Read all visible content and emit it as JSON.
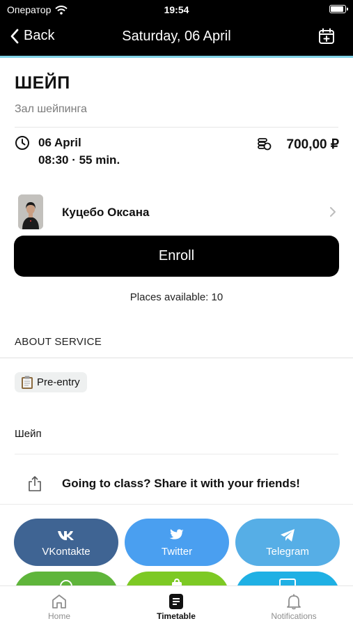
{
  "status_bar": {
    "carrier": "Оператор",
    "time": "19:54"
  },
  "nav": {
    "back_label": "Back",
    "title": "Saturday, 06 April"
  },
  "class": {
    "title": "ШЕЙП",
    "hall": "Зал шейпинга",
    "date": "06 April",
    "time_duration": "08:30 · 55 min.",
    "price": "700,00 ₽"
  },
  "trainer": {
    "name": "Куцебо Оксана"
  },
  "enroll_label": "Enroll",
  "places": "Places available: 10",
  "about": {
    "heading": "ABOUT SERVICE",
    "chip_label": "Pre-entry",
    "description": "Шейп"
  },
  "share": {
    "text": "Going to class? Share it with your friends!",
    "buttons": [
      {
        "label": "VKontakte",
        "color": "#3f6493"
      },
      {
        "label": "Twitter",
        "color": "#4a9ff0"
      },
      {
        "label": "Telegram",
        "color": "#56aee6"
      }
    ],
    "row2_colors": [
      "#5fb53b",
      "#7dc924",
      "#1fb0e4"
    ]
  },
  "tabs": [
    {
      "label": "Home",
      "icon": "home-icon",
      "active": false
    },
    {
      "label": "Timetable",
      "icon": "timetable-icon",
      "active": true
    },
    {
      "label": "Notifications",
      "icon": "bell-icon",
      "active": false
    }
  ]
}
